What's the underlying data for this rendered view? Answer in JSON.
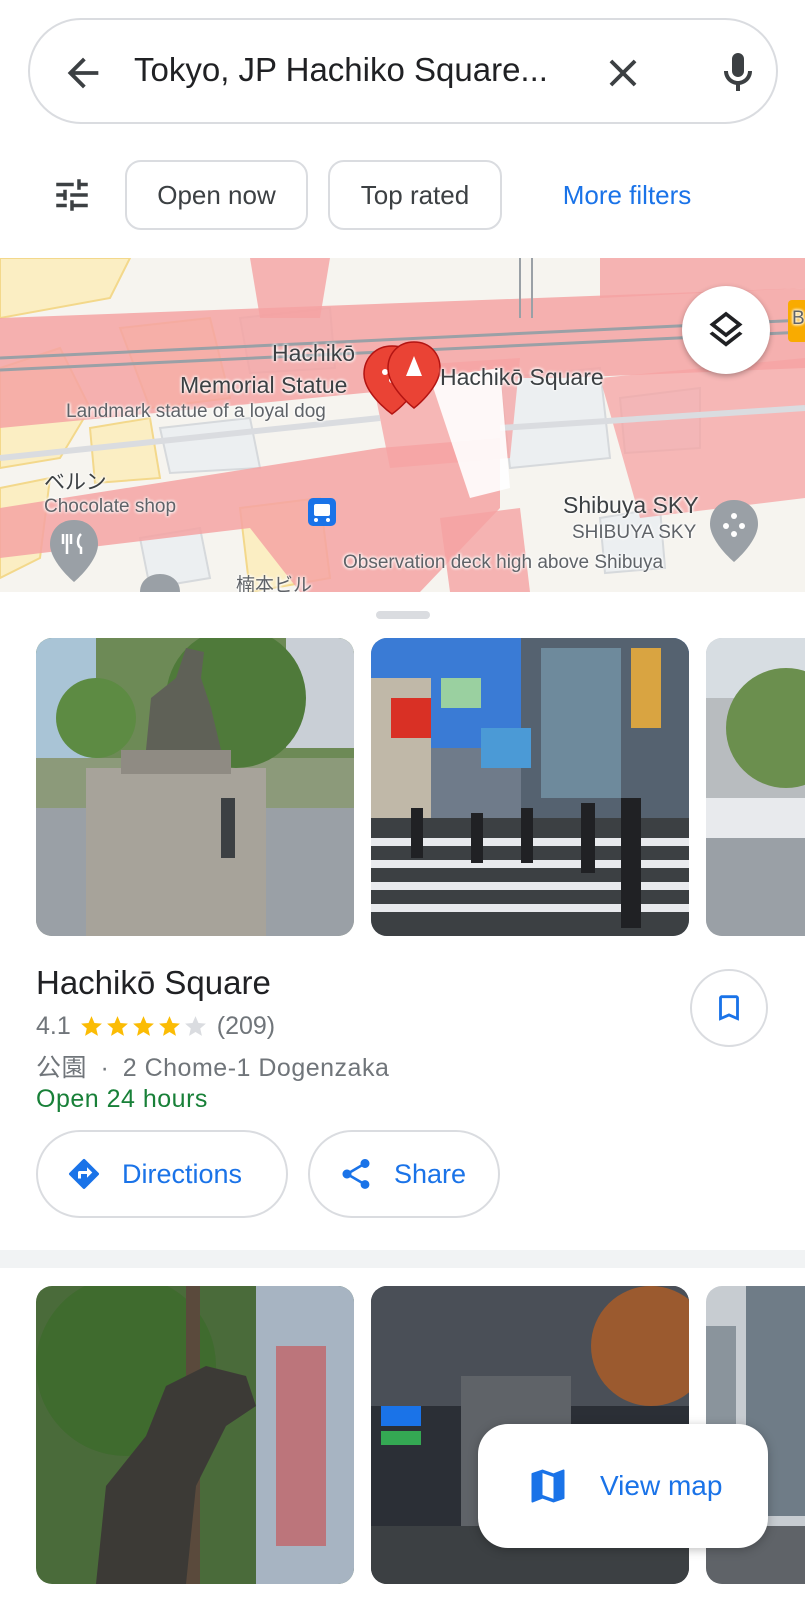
{
  "search": {
    "query": "Tokyo, JP Hachiko Square..."
  },
  "filters": {
    "open_now": "Open now",
    "top_rated": "Top rated",
    "more_filters": "More filters"
  },
  "map": {
    "labels": {
      "memorial_line1": "Hachikō",
      "memorial_line2": "Memorial Statue",
      "memorial_desc": "Landmark statue of a loyal dog",
      "square": "Hachikō Square",
      "berun": "ベルン",
      "chocolate": "Chocolate shop",
      "sky_en": "Shibuya SKY",
      "sky_ja": "SHIBUYA SKY",
      "observation": "Observation deck high above Shibuya",
      "kusumoto": "楠本ビル",
      "edge_b": "B"
    }
  },
  "place": {
    "name": "Hachikō Square",
    "rating": "4.1",
    "rating_value": 4.1,
    "review_count": "(209)",
    "category": "公園",
    "separator": "·",
    "address": "2 Chome-1 Dogenzaka",
    "hours": "Open 24 hours"
  },
  "actions": {
    "directions": "Directions",
    "share": "Share"
  },
  "view_map": "View map",
  "colors": {
    "accent": "#1a73e8",
    "open": "#188038",
    "star": "#fbbc04",
    "star_empty": "#dadce0",
    "map_road": "#f5a3a3",
    "pin": "#ea4335"
  },
  "icons": {
    "back": "arrow-left-icon",
    "clear": "close-icon",
    "mic": "mic-icon",
    "filters": "tune-icon",
    "layers": "layers-icon",
    "save": "bookmark-icon",
    "directions": "directions-icon",
    "share": "share-icon",
    "view_map": "map-icon"
  }
}
